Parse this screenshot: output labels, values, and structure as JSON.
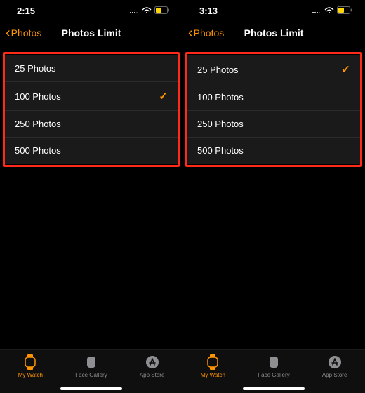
{
  "screens": [
    {
      "status": {
        "time": "2:15"
      },
      "nav": {
        "back_label": "Photos",
        "title": "Photos Limit"
      },
      "options": [
        {
          "label": "25 Photos",
          "selected": false
        },
        {
          "label": "100 Photos",
          "selected": true
        },
        {
          "label": "250 Photos",
          "selected": false
        },
        {
          "label": "500 Photos",
          "selected": false
        }
      ]
    },
    {
      "status": {
        "time": "3:13"
      },
      "nav": {
        "back_label": "Photos",
        "title": "Photos Limit"
      },
      "options": [
        {
          "label": "25 Photos",
          "selected": true
        },
        {
          "label": "100 Photos",
          "selected": false
        },
        {
          "label": "250 Photos",
          "selected": false
        },
        {
          "label": "500 Photos",
          "selected": false
        }
      ]
    }
  ],
  "tabs": [
    {
      "label": "My Watch",
      "active": true
    },
    {
      "label": "Face Gallery",
      "active": false
    },
    {
      "label": "App Store",
      "active": false
    }
  ],
  "colors": {
    "accent": "#ff9500",
    "highlight_border": "#ff2a1a",
    "row_bg": "#1a1a1a"
  },
  "checkmark_glyph": "✓"
}
